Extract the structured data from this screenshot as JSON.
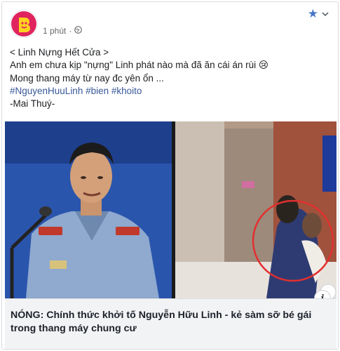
{
  "post": {
    "time": "1 phút",
    "separator": "·",
    "lines": [
      "< Linh Nựng Hết Cửa >",
      "Anh em chưa kịp \"nựng\" Linh phát nào mà đã ăn cái án rùi 😢",
      "Mong thang máy từ nay đc yên ổn ..."
    ],
    "hashtags": "#NguyenHuuLinh #bien #khoito",
    "signature": "-Mai Thuý-",
    "icons": {
      "avatar": "brand-logo-icon",
      "privacy": "globe-icon",
      "pin": "star-icon",
      "menu": "chevron-down-icon",
      "info": "info-icon"
    }
  },
  "link_preview": {
    "headline": "NÓNG: Chính thức khởi tố Nguyễn Hữu Linh - kẻ sàm sỡ bé gái trong thang máy chung cư",
    "info_label": "i"
  },
  "colors": {
    "link_blue": "#385898",
    "accent_star": "#4a76c8",
    "avatar_bg": "#e0245e",
    "caption_bg": "#f2f3f5"
  }
}
